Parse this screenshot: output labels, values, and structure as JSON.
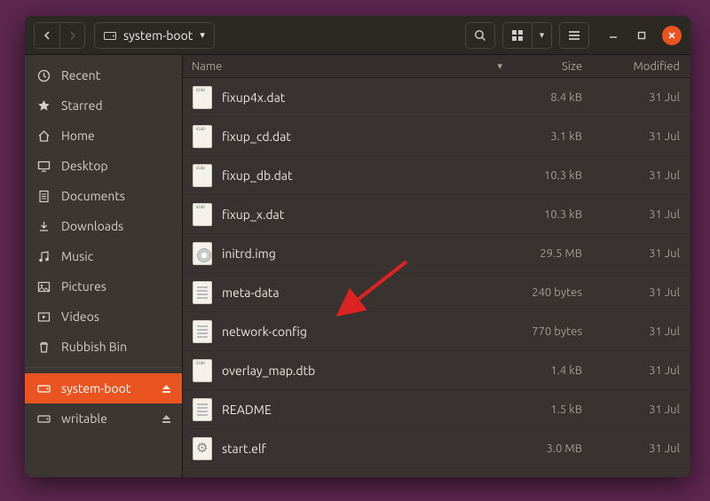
{
  "titlebar": {
    "path_label": "system-boot"
  },
  "columns": {
    "name": "Name",
    "size": "Size",
    "modified": "Modified"
  },
  "sidebar": {
    "items": [
      {
        "icon": "clock",
        "label": "Recent"
      },
      {
        "icon": "star",
        "label": "Starred"
      },
      {
        "icon": "home",
        "label": "Home"
      },
      {
        "icon": "desktop",
        "label": "Desktop"
      },
      {
        "icon": "docs",
        "label": "Documents"
      },
      {
        "icon": "downloads",
        "label": "Downloads"
      },
      {
        "icon": "music",
        "label": "Music"
      },
      {
        "icon": "pictures",
        "label": "Pictures"
      },
      {
        "icon": "videos",
        "label": "Videos"
      },
      {
        "icon": "trash",
        "label": "Rubbish Bin"
      }
    ],
    "mounts": [
      {
        "icon": "drive",
        "label": "system-boot",
        "active": true,
        "eject": true
      },
      {
        "icon": "drive",
        "label": "writable",
        "active": false,
        "eject": true
      }
    ]
  },
  "files": [
    {
      "icon": "bin",
      "name": "fixup4x.dat",
      "size": "8.4 kB",
      "modified": "31 Jul"
    },
    {
      "icon": "bin",
      "name": "fixup_cd.dat",
      "size": "3.1 kB",
      "modified": "31 Jul"
    },
    {
      "icon": "bin",
      "name": "fixup_db.dat",
      "size": "10.3 kB",
      "modified": "31 Jul"
    },
    {
      "icon": "bin",
      "name": "fixup_x.dat",
      "size": "10.3 kB",
      "modified": "31 Jul"
    },
    {
      "icon": "img",
      "name": "initrd.img",
      "size": "29.5 MB",
      "modified": "31 Jul"
    },
    {
      "icon": "txt",
      "name": "meta-data",
      "size": "240 bytes",
      "modified": "31 Jul"
    },
    {
      "icon": "txt",
      "name": "network-config",
      "size": "770 bytes",
      "modified": "31 Jul"
    },
    {
      "icon": "bin",
      "name": "overlay_map.dtb",
      "size": "1.4 kB",
      "modified": "31 Jul"
    },
    {
      "icon": "txt",
      "name": "README",
      "size": "1.5 kB",
      "modified": "31 Jul"
    },
    {
      "icon": "gear",
      "name": "start.elf",
      "size": "3.0 MB",
      "modified": "31 Jul"
    }
  ],
  "annotation": {
    "target_file": "network-config"
  }
}
